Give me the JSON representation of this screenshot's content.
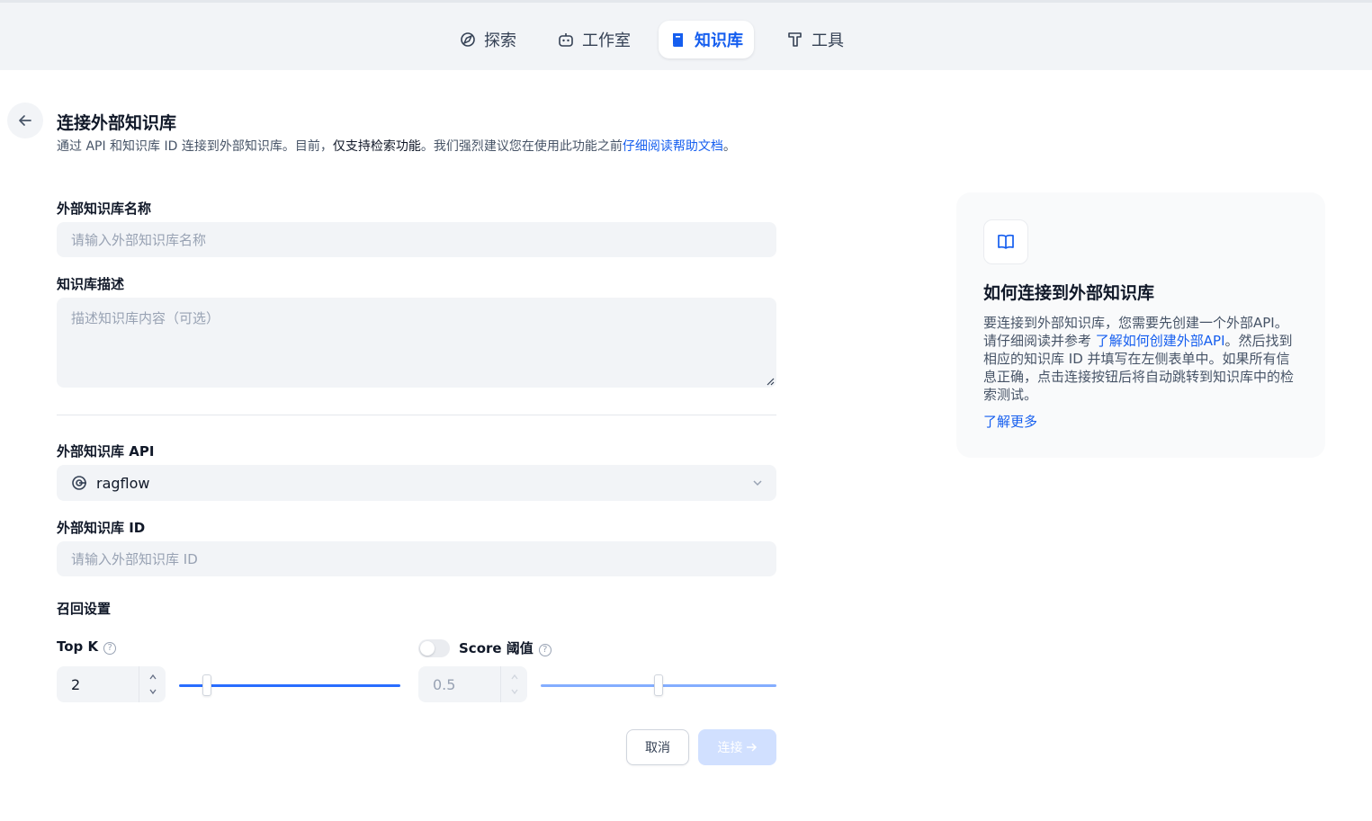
{
  "nav": {
    "explore": "探索",
    "studio": "工作室",
    "knowledge": "知识库",
    "tools": "工具"
  },
  "header": {
    "title": "连接外部知识库",
    "intro_part1": "通过 API 和知识库 ID 连接到外部知识库。目前，",
    "intro_strong": "仅支持检索功能",
    "intro_part2": "。我们强烈建议您在使用此功能之前",
    "intro_link": "仔细阅读帮助文档",
    "intro_end": "。"
  },
  "form": {
    "name_label": "外部知识库名称",
    "name_placeholder": "请输入外部知识库名称",
    "desc_label": "知识库描述",
    "desc_placeholder": "描述知识库内容（可选）",
    "api_label": "外部知识库 API",
    "api_value": "ragflow",
    "id_label": "外部知识库 ID",
    "id_placeholder": "请输入外部知识库 ID",
    "retrieval_label": "召回设置",
    "topk_label": "Top K",
    "topk_value": "2",
    "score_label": "Score 阈值",
    "score_value": "0.5",
    "score_enabled": false,
    "cancel_label": "取消",
    "connect_label": "连接"
  },
  "help_card": {
    "title": "如何连接到外部知识库",
    "body1": "要连接到外部知识库，您需要先创建一个外部API。请仔细阅读并参考 ",
    "body_link": "了解如何创建外部API",
    "body2": "。然后找到相应的知识库 ID 并填写在左侧表单中。如果所有信息正确，点击连接按钮后将自动跳转到知识库中的检索测试。",
    "more_link": "了解更多"
  },
  "colors": {
    "accent": "#155eef",
    "slider_active": "#296dff",
    "slider_disabled": "#84adff"
  }
}
